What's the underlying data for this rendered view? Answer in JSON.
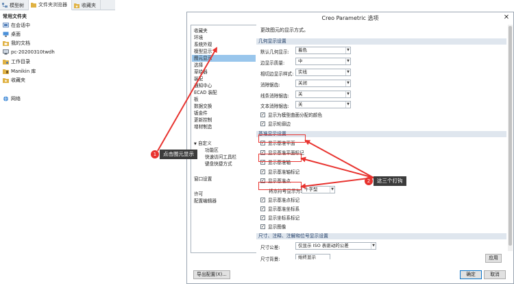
{
  "left_tabs": [
    {
      "label": "模型树",
      "icon": "model-tree-icon",
      "color": "#6b8fb8"
    },
    {
      "label": "文件夹浏览器",
      "icon": "folder-browser-icon",
      "color": "#e0b243"
    },
    {
      "label": "收藏夹",
      "icon": "favorites-icon",
      "color": "#e0b243"
    }
  ],
  "left_nav": {
    "header": "常用文件夹",
    "items": [
      {
        "label": "在会话中",
        "icon": "session-icon"
      },
      {
        "label": "桌面",
        "icon": "desktop-icon"
      },
      {
        "label": "我的文档",
        "icon": "documents-folder-icon"
      },
      {
        "label": "pc-20200310twdh",
        "icon": "computer-icon"
      },
      {
        "label": "工作目录",
        "icon": "working-directory-icon"
      },
      {
        "label": "Manikin 库",
        "icon": "manikin-library-icon"
      },
      {
        "label": "收藏夹",
        "icon": "favorites-folder-icon"
      },
      {
        "label": "网络",
        "icon": "network-icon"
      }
    ]
  },
  "dialog": {
    "title": "Creo Parametric 选项",
    "close": "✕",
    "sidebar": {
      "items": [
        "收藏夹",
        "环境",
        "系统外观",
        "模型显示",
        "图元显示",
        "选择",
        "草绘器",
        "装配",
        "通知中心",
        "ECAD 装配",
        "板",
        "数据交换",
        "钣金件",
        "更新控制",
        "增材制造"
      ],
      "selected_index": 4,
      "customize": "自定义",
      "customize_children": [
        "功能区",
        "快速访问工具栏",
        "键盘快捷方式"
      ],
      "window_settings": "窗口设置",
      "license": "许可",
      "config_editor": "配置编辑器"
    },
    "content_title": "更改图元的显示方式。",
    "geom_section": {
      "title": "几何显示设置",
      "rows": [
        {
          "label": "默认几何显示:",
          "value": "着色"
        },
        {
          "label": "边显示质量:",
          "value": "中"
        },
        {
          "label": "相切边显示样式:",
          "value": "实线"
        },
        {
          "label": "消除锯齿:",
          "value": "关闭"
        },
        {
          "label": "线条消除锯齿:",
          "value": "关"
        },
        {
          "label": "文本消除锯齿:",
          "value": "关"
        }
      ],
      "checks": [
        {
          "label": "显示为模型曲面分配的颜色",
          "checked": true
        },
        {
          "label": "显示轮廓边",
          "checked": true
        }
      ]
    },
    "datum_section": {
      "title": "基准显示设置",
      "checks_a": [
        {
          "label": "显示基准平面",
          "checked": true
        },
        {
          "label": "显示基准平面标记",
          "checked": true
        },
        {
          "label": "显示基准轴",
          "checked": true
        },
        {
          "label": "显示基准轴标记",
          "checked": true
        },
        {
          "label": "显示基准点",
          "checked": true
        }
      ],
      "point_symbol_label": "将点符号显示为:",
      "point_symbol_value": "十字型",
      "checks_b": [
        {
          "label": "显示基准点标记",
          "checked": true
        },
        {
          "label": "显示基准坐标系",
          "checked": true
        },
        {
          "label": "显示坐标系标记",
          "checked": true
        },
        {
          "label": "显示图像",
          "checked": true
        }
      ]
    },
    "dim_section": {
      "title": "尺寸、注释、注解和位号显示设置",
      "rows": [
        {
          "label": "尺寸公差:",
          "value": "仅显示 ISO 表驱动的公差"
        },
        {
          "label": "尺寸背景:",
          "value": "始终显示"
        }
      ]
    },
    "apply": "应用",
    "export": "导出配置(X)...",
    "ok": "确定",
    "cancel": "取消"
  },
  "annotations": {
    "a1": {
      "number": "1",
      "text": "点击图元显示"
    },
    "a2": {
      "number": "2",
      "text": "这三个打钩"
    }
  },
  "colors": {
    "accent_red": "#e8332f",
    "selection_blue": "#99c6ec",
    "section_bg": "#dfe6ee"
  }
}
